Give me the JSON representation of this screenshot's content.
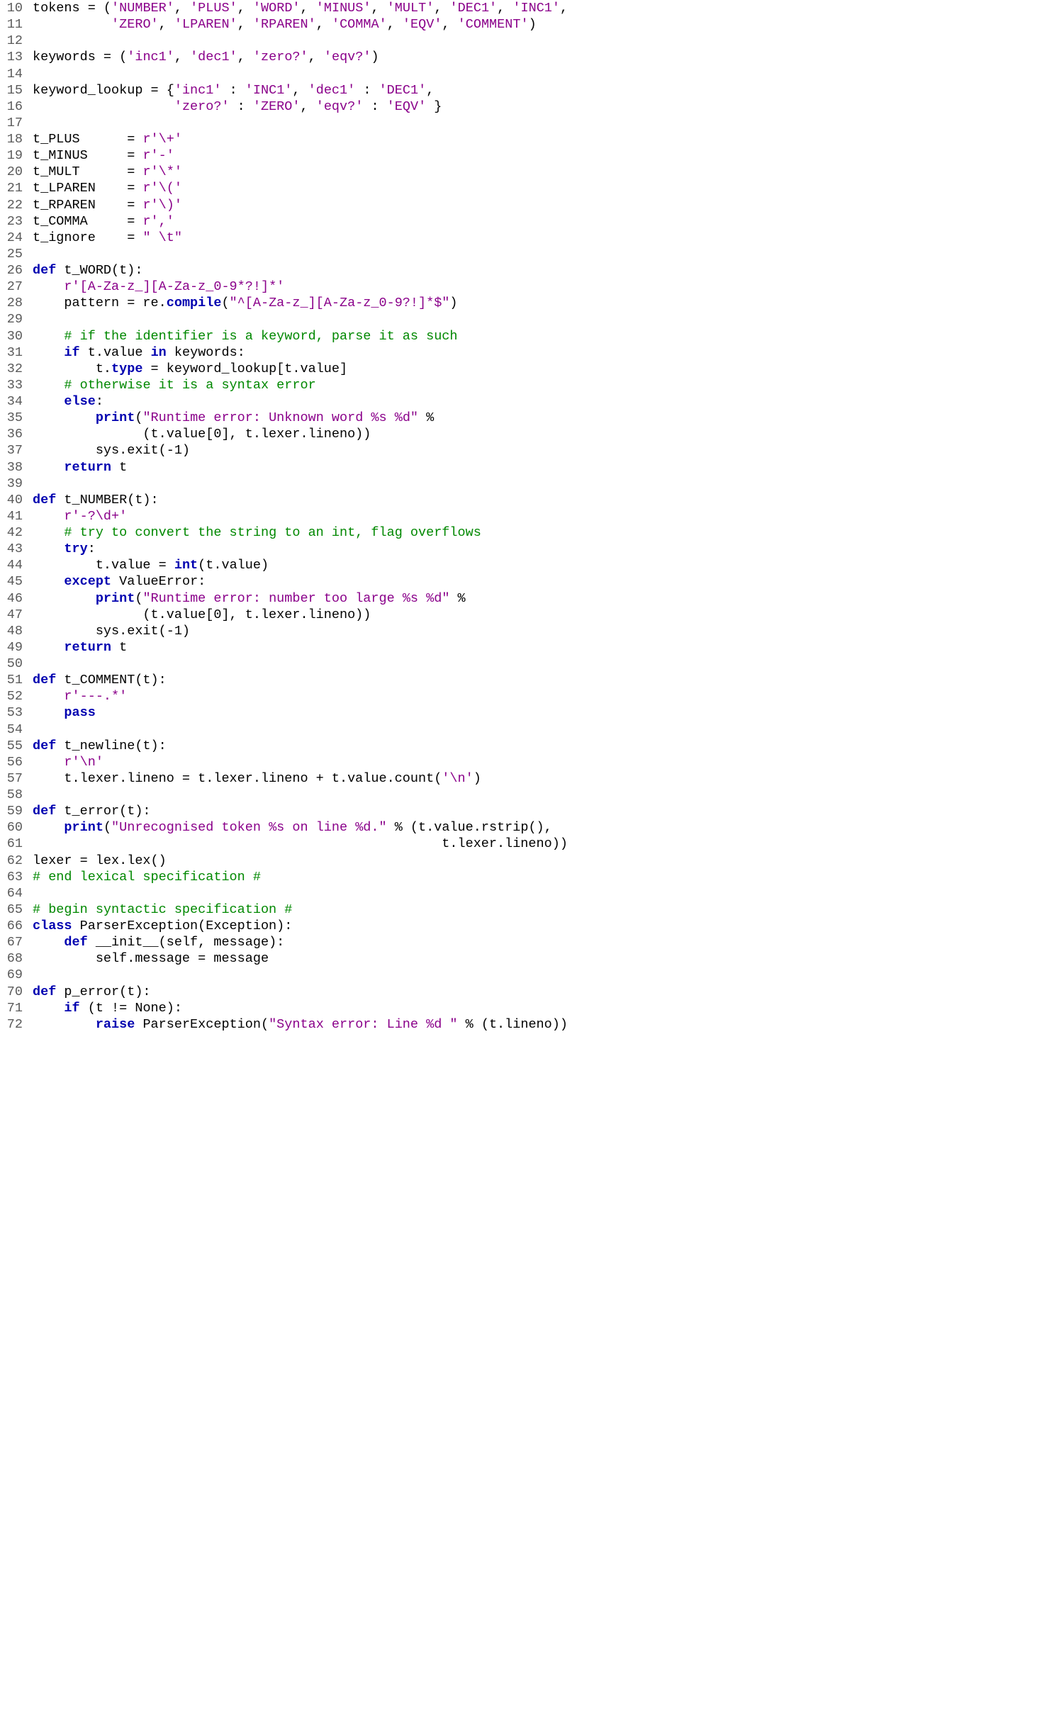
{
  "lines": [
    {
      "n": "10",
      "segs": [
        [
          "pl",
          "tokens = ("
        ],
        [
          "str",
          "'NUMBER'"
        ],
        [
          "pl",
          ", "
        ],
        [
          "str",
          "'PLUS'"
        ],
        [
          "pl",
          ", "
        ],
        [
          "str",
          "'WORD'"
        ],
        [
          "pl",
          ", "
        ],
        [
          "str",
          "'MINUS'"
        ],
        [
          "pl",
          ", "
        ],
        [
          "str",
          "'MULT'"
        ],
        [
          "pl",
          ", "
        ],
        [
          "str",
          "'DEC1'"
        ],
        [
          "pl",
          ", "
        ],
        [
          "str",
          "'INC1'"
        ],
        [
          "pl",
          ","
        ]
      ]
    },
    {
      "n": "11",
      "segs": [
        [
          "pl",
          "          "
        ],
        [
          "str",
          "'ZERO'"
        ],
        [
          "pl",
          ", "
        ],
        [
          "str",
          "'LPAREN'"
        ],
        [
          "pl",
          ", "
        ],
        [
          "str",
          "'RPAREN'"
        ],
        [
          "pl",
          ", "
        ],
        [
          "str",
          "'COMMA'"
        ],
        [
          "pl",
          ", "
        ],
        [
          "str",
          "'EQV'"
        ],
        [
          "pl",
          ", "
        ],
        [
          "str",
          "'COMMENT'"
        ],
        [
          "pl",
          ")"
        ]
      ]
    },
    {
      "n": "12",
      "segs": [
        [
          "pl",
          ""
        ]
      ]
    },
    {
      "n": "13",
      "segs": [
        [
          "pl",
          "keywords = ("
        ],
        [
          "str",
          "'inc1'"
        ],
        [
          "pl",
          ", "
        ],
        [
          "str",
          "'dec1'"
        ],
        [
          "pl",
          ", "
        ],
        [
          "str",
          "'zero?'"
        ],
        [
          "pl",
          ", "
        ],
        [
          "str",
          "'eqv?'"
        ],
        [
          "pl",
          ")"
        ]
      ]
    },
    {
      "n": "14",
      "segs": [
        [
          "pl",
          ""
        ]
      ]
    },
    {
      "n": "15",
      "segs": [
        [
          "pl",
          "keyword_lookup = {"
        ],
        [
          "str",
          "'inc1'"
        ],
        [
          "pl",
          " : "
        ],
        [
          "str",
          "'INC1'"
        ],
        [
          "pl",
          ", "
        ],
        [
          "str",
          "'dec1'"
        ],
        [
          "pl",
          " : "
        ],
        [
          "str",
          "'DEC1'"
        ],
        [
          "pl",
          ","
        ]
      ]
    },
    {
      "n": "16",
      "segs": [
        [
          "pl",
          "                  "
        ],
        [
          "str",
          "'zero?'"
        ],
        [
          "pl",
          " : "
        ],
        [
          "str",
          "'ZERO'"
        ],
        [
          "pl",
          ", "
        ],
        [
          "str",
          "'eqv?'"
        ],
        [
          "pl",
          " : "
        ],
        [
          "str",
          "'EQV'"
        ],
        [
          "pl",
          " }"
        ]
      ]
    },
    {
      "n": "17",
      "segs": [
        [
          "pl",
          ""
        ]
      ]
    },
    {
      "n": "18",
      "segs": [
        [
          "pl",
          "t_PLUS      = "
        ],
        [
          "str",
          "r'\\+'"
        ]
      ]
    },
    {
      "n": "19",
      "segs": [
        [
          "pl",
          "t_MINUS     = "
        ],
        [
          "str",
          "r'-'"
        ]
      ]
    },
    {
      "n": "20",
      "segs": [
        [
          "pl",
          "t_MULT      = "
        ],
        [
          "str",
          "r'\\*'"
        ]
      ]
    },
    {
      "n": "21",
      "segs": [
        [
          "pl",
          "t_LPAREN    = "
        ],
        [
          "str",
          "r'\\('"
        ]
      ]
    },
    {
      "n": "22",
      "segs": [
        [
          "pl",
          "t_RPAREN    = "
        ],
        [
          "str",
          "r'\\)'"
        ]
      ]
    },
    {
      "n": "23",
      "segs": [
        [
          "pl",
          "t_COMMA     = "
        ],
        [
          "str",
          "r','"
        ]
      ]
    },
    {
      "n": "24",
      "segs": [
        [
          "pl",
          "t_ignore    = "
        ],
        [
          "str",
          "\" \\t\""
        ]
      ]
    },
    {
      "n": "25",
      "segs": [
        [
          "pl",
          ""
        ]
      ]
    },
    {
      "n": "26",
      "segs": [
        [
          "kw",
          "def"
        ],
        [
          "pl",
          " t_WORD(t):"
        ]
      ]
    },
    {
      "n": "27",
      "segs": [
        [
          "pl",
          "    "
        ],
        [
          "str",
          "r'[A-Za-z_][A-Za-z_0-9*?!]*'"
        ]
      ]
    },
    {
      "n": "28",
      "segs": [
        [
          "pl",
          "    pattern = re."
        ],
        [
          "fn",
          "compile"
        ],
        [
          "pl",
          "("
        ],
        [
          "str",
          "\"^[A-Za-z_][A-Za-z_0-9?!]*$\""
        ],
        [
          "pl",
          ")"
        ]
      ]
    },
    {
      "n": "29",
      "segs": [
        [
          "pl",
          ""
        ]
      ]
    },
    {
      "n": "30",
      "segs": [
        [
          "pl",
          "    "
        ],
        [
          "cm",
          "# if the identifier is a keyword, parse it as such"
        ]
      ]
    },
    {
      "n": "31",
      "segs": [
        [
          "pl",
          "    "
        ],
        [
          "kw",
          "if"
        ],
        [
          "pl",
          " t.value "
        ],
        [
          "kw",
          "in"
        ],
        [
          "pl",
          " keywords:"
        ]
      ]
    },
    {
      "n": "32",
      "segs": [
        [
          "pl",
          "        t."
        ],
        [
          "fn",
          "type"
        ],
        [
          "pl",
          " = keyword_lookup[t.value]"
        ]
      ]
    },
    {
      "n": "33",
      "segs": [
        [
          "pl",
          "    "
        ],
        [
          "cm",
          "# otherwise it is a syntax error"
        ]
      ]
    },
    {
      "n": "34",
      "segs": [
        [
          "pl",
          "    "
        ],
        [
          "kw",
          "else"
        ],
        [
          "pl",
          ":"
        ]
      ]
    },
    {
      "n": "35",
      "segs": [
        [
          "pl",
          "        "
        ],
        [
          "fn",
          "print"
        ],
        [
          "pl",
          "("
        ],
        [
          "str",
          "\"Runtime error: Unknown word %s %d\""
        ],
        [
          "pl",
          " %"
        ]
      ]
    },
    {
      "n": "36",
      "segs": [
        [
          "pl",
          "              (t.value[0], t.lexer.lineno))"
        ]
      ]
    },
    {
      "n": "37",
      "segs": [
        [
          "pl",
          "        sys.exit(-1)"
        ]
      ]
    },
    {
      "n": "38",
      "segs": [
        [
          "pl",
          "    "
        ],
        [
          "kw",
          "return"
        ],
        [
          "pl",
          " t"
        ]
      ]
    },
    {
      "n": "39",
      "segs": [
        [
          "pl",
          ""
        ]
      ]
    },
    {
      "n": "40",
      "segs": [
        [
          "kw",
          "def"
        ],
        [
          "pl",
          " t_NUMBER(t):"
        ]
      ]
    },
    {
      "n": "41",
      "segs": [
        [
          "pl",
          "    "
        ],
        [
          "str",
          "r'-?\\d+'"
        ]
      ]
    },
    {
      "n": "42",
      "segs": [
        [
          "pl",
          "    "
        ],
        [
          "cm",
          "# try to convert the string to an int, flag overflows"
        ]
      ]
    },
    {
      "n": "43",
      "segs": [
        [
          "pl",
          "    "
        ],
        [
          "kw",
          "try"
        ],
        [
          "pl",
          ":"
        ]
      ]
    },
    {
      "n": "44",
      "segs": [
        [
          "pl",
          "        t.value = "
        ],
        [
          "fn",
          "int"
        ],
        [
          "pl",
          "(t.value)"
        ]
      ]
    },
    {
      "n": "45",
      "segs": [
        [
          "pl",
          "    "
        ],
        [
          "kw",
          "except"
        ],
        [
          "pl",
          " ValueError:"
        ]
      ]
    },
    {
      "n": "46",
      "segs": [
        [
          "pl",
          "        "
        ],
        [
          "fn",
          "print"
        ],
        [
          "pl",
          "("
        ],
        [
          "str",
          "\"Runtime error: number too large %s %d\""
        ],
        [
          "pl",
          " %"
        ]
      ]
    },
    {
      "n": "47",
      "segs": [
        [
          "pl",
          "              (t.value[0], t.lexer.lineno))"
        ]
      ]
    },
    {
      "n": "48",
      "segs": [
        [
          "pl",
          "        sys.exit(-1)"
        ]
      ]
    },
    {
      "n": "49",
      "segs": [
        [
          "pl",
          "    "
        ],
        [
          "kw",
          "return"
        ],
        [
          "pl",
          " t"
        ]
      ]
    },
    {
      "n": "50",
      "segs": [
        [
          "pl",
          ""
        ]
      ]
    },
    {
      "n": "51",
      "segs": [
        [
          "kw",
          "def"
        ],
        [
          "pl",
          " t_COMMENT(t):"
        ]
      ]
    },
    {
      "n": "52",
      "segs": [
        [
          "pl",
          "    "
        ],
        [
          "str",
          "r'---.*'"
        ]
      ]
    },
    {
      "n": "53",
      "segs": [
        [
          "pl",
          "    "
        ],
        [
          "kw",
          "pass"
        ]
      ]
    },
    {
      "n": "54",
      "segs": [
        [
          "pl",
          ""
        ]
      ]
    },
    {
      "n": "55",
      "segs": [
        [
          "kw",
          "def"
        ],
        [
          "pl",
          " t_newline(t):"
        ]
      ]
    },
    {
      "n": "56",
      "segs": [
        [
          "pl",
          "    "
        ],
        [
          "str",
          "r'\\n'"
        ]
      ]
    },
    {
      "n": "57",
      "segs": [
        [
          "pl",
          "    t.lexer.lineno = t.lexer.lineno + t.value.count("
        ],
        [
          "str",
          "'\\n'"
        ],
        [
          "pl",
          ")"
        ]
      ]
    },
    {
      "n": "58",
      "segs": [
        [
          "pl",
          ""
        ]
      ]
    },
    {
      "n": "59",
      "segs": [
        [
          "kw",
          "def"
        ],
        [
          "pl",
          " t_error(t):"
        ]
      ]
    },
    {
      "n": "60",
      "segs": [
        [
          "pl",
          "    "
        ],
        [
          "fn",
          "print"
        ],
        [
          "pl",
          "("
        ],
        [
          "str",
          "\"Unrecognised token %s on line %d.\""
        ],
        [
          "pl",
          " % (t.value.rstrip(),"
        ]
      ]
    },
    {
      "n": "61",
      "segs": [
        [
          "pl",
          "                                                    t.lexer.lineno))"
        ]
      ]
    },
    {
      "n": "62",
      "segs": [
        [
          "pl",
          "lexer = lex.lex()"
        ]
      ]
    },
    {
      "n": "63",
      "segs": [
        [
          "cm",
          "# end lexical specification #"
        ]
      ]
    },
    {
      "n": "64",
      "segs": [
        [
          "pl",
          ""
        ]
      ]
    },
    {
      "n": "65",
      "segs": [
        [
          "cm",
          "# begin syntactic specification #"
        ]
      ]
    },
    {
      "n": "66",
      "segs": [
        [
          "kw",
          "class"
        ],
        [
          "pl",
          " ParserException(Exception):"
        ]
      ]
    },
    {
      "n": "67",
      "segs": [
        [
          "pl",
          "    "
        ],
        [
          "kw",
          "def"
        ],
        [
          "pl",
          " __init__(self, message):"
        ]
      ]
    },
    {
      "n": "68",
      "segs": [
        [
          "pl",
          "        self.message = message"
        ]
      ]
    },
    {
      "n": "69",
      "segs": [
        [
          "pl",
          ""
        ]
      ]
    },
    {
      "n": "70",
      "segs": [
        [
          "kw",
          "def"
        ],
        [
          "pl",
          " p_error(t):"
        ]
      ]
    },
    {
      "n": "71",
      "segs": [
        [
          "pl",
          "    "
        ],
        [
          "kw",
          "if"
        ],
        [
          "pl",
          " (t != None):"
        ]
      ]
    },
    {
      "n": "72",
      "segs": [
        [
          "pl",
          "        "
        ],
        [
          "kw",
          "raise"
        ],
        [
          "pl",
          " ParserException("
        ],
        [
          "str",
          "\"Syntax error: Line %d \""
        ],
        [
          "pl",
          " % (t.lineno))"
        ]
      ]
    }
  ]
}
